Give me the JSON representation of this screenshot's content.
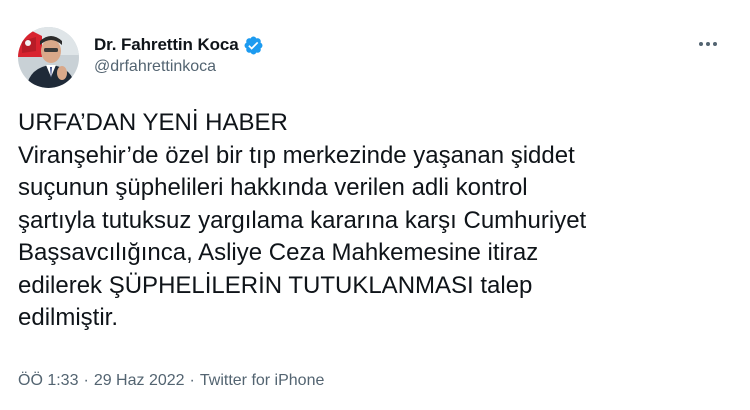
{
  "author": {
    "display_name": "Dr. Fahrettin Koca",
    "handle": "@drfahrettinkoca",
    "verified": true
  },
  "tweet": {
    "lines": [
      "URFA’DAN YENİ HABER",
      "Viranşehir’de özel bir tıp merkezinde yaşanan şiddet",
      "suçunun şüphelileri hakkında verilen adli kontrol",
      "şartıyla tutuksuz yargılama kararına karşı Cumhuriyet",
      "Başsavcılığınca, Asliye Ceza Mahkemesine itiraz",
      "edilerek ŞÜPHELİLERİN TUTUKLANMASI talep",
      "edilmiştir."
    ]
  },
  "meta": {
    "time": "ÖÖ 1:33",
    "separator": "·",
    "date": "29 Haz 2022",
    "source": "Twitter for iPhone"
  },
  "icons": {
    "verified": "verified-badge-icon",
    "more": "more-options-icon"
  },
  "colors": {
    "text_primary": "#0f1419",
    "text_secondary": "#536471",
    "verified_blue": "#1d9bf0",
    "background": "#ffffff"
  }
}
